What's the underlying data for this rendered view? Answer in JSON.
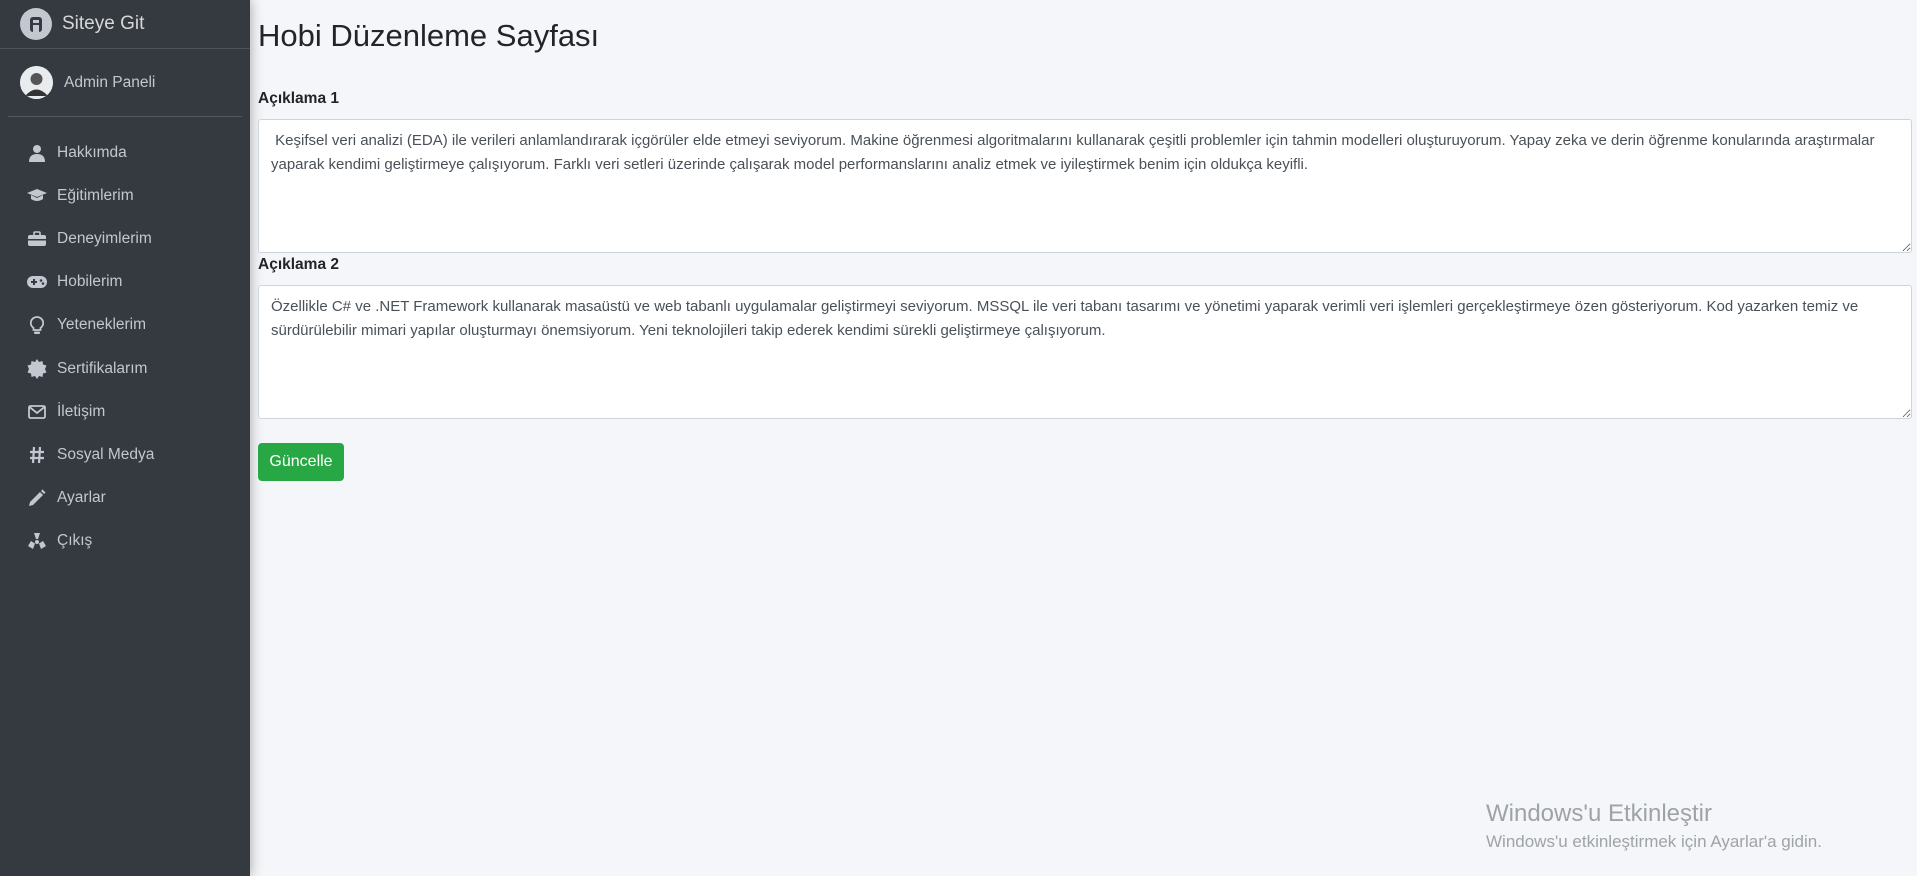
{
  "sidebar": {
    "brand": {
      "title": "Siteye Git",
      "icon": "logo-icon"
    },
    "user": {
      "name": "Admin Paneli",
      "avatar": "avatar"
    },
    "items": [
      {
        "label": "Hakkımda",
        "icon": "user-icon"
      },
      {
        "label": "Eğitimlerim",
        "icon": "graduation-cap-icon"
      },
      {
        "label": "Deneyimlerim",
        "icon": "briefcase-icon"
      },
      {
        "label": "Hobilerim",
        "icon": "gamepad-icon"
      },
      {
        "label": "Yeteneklerim",
        "icon": "lightbulb-icon"
      },
      {
        "label": "Sertifikalarım",
        "icon": "certificate-icon"
      },
      {
        "label": "İletişim",
        "icon": "envelope-icon"
      },
      {
        "label": "Sosyal Medya",
        "icon": "hashtag-icon"
      },
      {
        "label": "Ayarlar",
        "icon": "pencil-icon"
      },
      {
        "label": "Çıkış",
        "icon": "radiation-icon"
      }
    ]
  },
  "main": {
    "title": "Hobi Düzenleme Sayfası",
    "field1": {
      "label": "Açıklama 1",
      "value": " Keşifsel veri analizi (EDA) ile verileri anlamlandırarak içgörüler elde etmeyi seviyorum. Makine öğrenmesi algoritmalarını kullanarak çeşitli problemler için tahmin modelleri oluşturuyorum. Yapay zeka ve derin öğrenme konularında araştırmalar yaparak kendimi geliştirmeye çalışıyorum. Farklı veri setleri üzerinde çalışarak model performanslarını analiz etmek ve iyileştirmek benim için oldukça keyifli."
    },
    "field2": {
      "label": "Açıklama 2",
      "value": "Özellikle C# ve .NET Framework kullanarak masaüstü ve web tabanlı uygulamalar geliştirmeyi seviyorum. MSSQL ile veri tabanı tasarımı ve yönetimi yaparak verimli veri işlemleri gerçekleştirmeye özen gösteriyorum. Kod yazarken temiz ve sürdürülebilir mimari yapılar oluşturmayı önemsiyorum. Yeni teknolojileri takip ederek kendimi sürekli geliştirmeye çalışıyorum."
    },
    "submit_label": "Güncelle"
  },
  "watermark": {
    "title": "Windows'u Etkinleştir",
    "subtitle": "Windows'u etkinleştirmek için Ayarlar'a gidin."
  },
  "colors": {
    "sidebar_bg": "#343a40",
    "content_bg": "#f4f6f9",
    "button_success": "#28a745"
  }
}
